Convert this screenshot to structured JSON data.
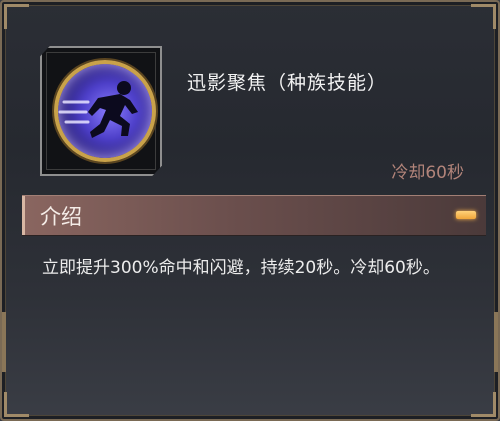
{
  "skill": {
    "name": "迅影聚焦（种族技能）",
    "cooldown_label": "冷却60秒",
    "icon": "running-figure-icon"
  },
  "section": {
    "title": "介绍",
    "toggle_icon": "collapse-icon"
  },
  "description": "立即提升300%命中和闪避，持续20秒。冷却60秒。",
  "colors": {
    "frame_gold": "#c9a24a",
    "orb_purple": "#4d3fc8",
    "cooldown_text": "#b2847a",
    "section_bar": "#8a6660",
    "toggle_orange": "#f0a63a"
  }
}
